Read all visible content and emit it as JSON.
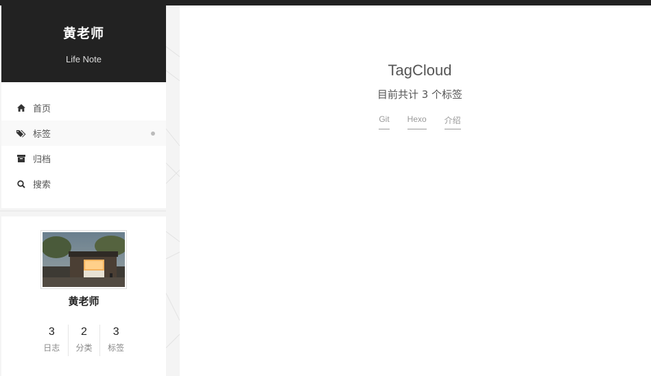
{
  "site": {
    "title": "黄老师",
    "subtitle": "Life Note"
  },
  "menu": {
    "items": [
      {
        "label": "首页",
        "icon": "home-icon"
      },
      {
        "label": "标签",
        "icon": "tags-icon",
        "active": true
      },
      {
        "label": "归档",
        "icon": "archive-icon"
      },
      {
        "label": "搜索",
        "icon": "search-icon"
      }
    ]
  },
  "profile": {
    "name": "黄老师",
    "stats": [
      {
        "count": "3",
        "label": "日志"
      },
      {
        "count": "2",
        "label": "分类"
      },
      {
        "count": "3",
        "label": "标签"
      }
    ]
  },
  "main": {
    "title": "TagCloud",
    "tag_count_text": "目前共计 3 个标签",
    "tags": [
      "Git",
      "Hexo",
      "介绍"
    ]
  },
  "colors": {
    "header_bg": "#222222",
    "accent_dot": "#bbbbbb",
    "tag_color": "#999999"
  }
}
